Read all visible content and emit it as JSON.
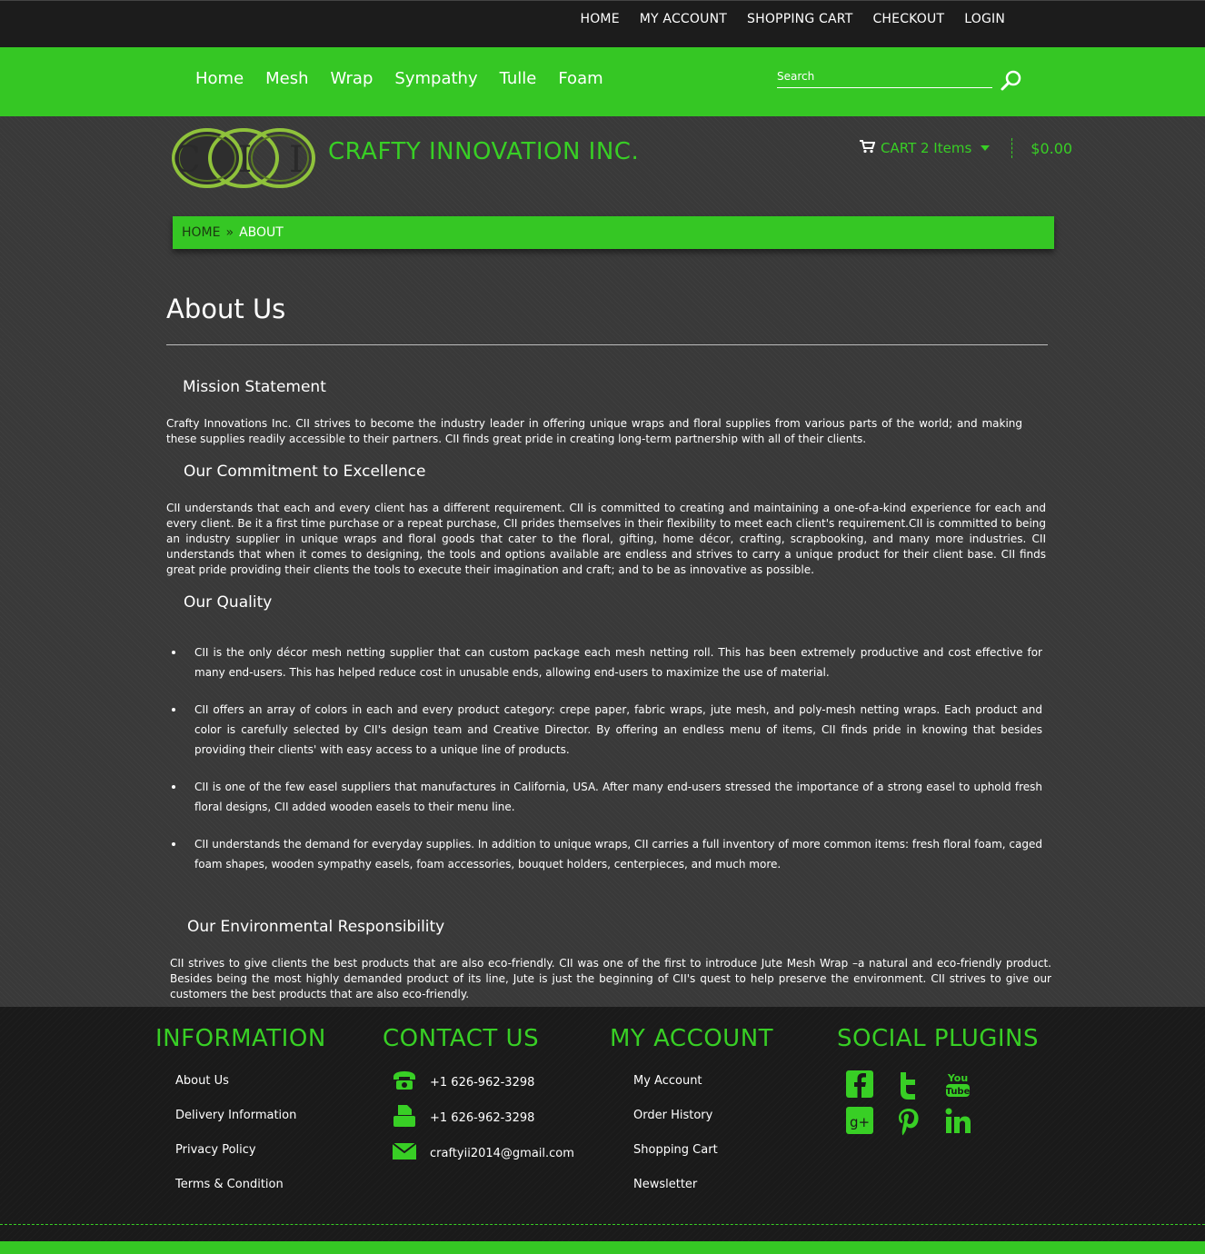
{
  "top_nav": [
    "HOME",
    "MY ACCOUNT",
    "SHOPPING CART",
    "CHECKOUT",
    "LOGIN"
  ],
  "main_nav": [
    "Home",
    "Mesh",
    "Wrap",
    "Sympathy",
    "Tulle",
    "Foam"
  ],
  "search": {
    "placeholder": "Search"
  },
  "brand": {
    "logo_text": "C I I",
    "name": "CRAFTY INNOVATION INC."
  },
  "cart": {
    "label": "CART 2 Items",
    "total": "$0.00"
  },
  "breadcrumb": {
    "home": "HOME",
    "separator": "»",
    "current": "ABOUT"
  },
  "page": {
    "title": "About Us",
    "mission": {
      "heading": "Mission Statement",
      "text": "Crafty Innovations Inc.    CII    strives to become the industry leader in offering unique wraps and floral supplies from various parts of the world; and making these supplies readily accessible to their partners. CII finds great pride in creating long-term partnership with all of their clients."
    },
    "commitment": {
      "heading": "Our Commitment to Excellence",
      "text": "CII understands that each and every client has a different requirement. CII is committed to creating and maintaining a one-of-a-kind experience for each and every client. Be it a first time purchase or a repeat purchase, CII prides themselves in their flexibility to meet each client's requirement.CII is committed to being an industry supplier in unique wraps and floral goods that cater to the floral, gifting, home décor, crafting, scrapbooking, and many more industries. CII understands that when it comes to designing, the tools and options available are endless and strives to carry a unique product for their client base. CII finds great pride providing their clients the tools to execute their imagination and craft; and to be as innovative as possible."
    },
    "quality": {
      "heading": "Our Quality",
      "items": [
        "CII is the only décor mesh netting supplier that can custom package each mesh netting roll. This has been extremely productive and cost effective for many end-users. This has helped reduce cost in unusable ends, allowing end-users to maximize the use of material.",
        "CII offers an array of colors in each and every product category: crepe paper, fabric wraps, jute mesh, and poly-mesh netting wraps. Each product and color is carefully selected by CII's design team and Creative Director. By offering an endless menu of items, CII finds pride in knowing that besides providing their clients' with easy access to a unique line of products.",
        "CII is one of the few easel suppliers that manufactures in California, USA. After many end-users stressed the importance of a strong easel to uphold fresh floral designs, CII added wooden easels to their menu line.",
        "CII understands the demand for everyday supplies. In addition to unique wraps, CII carries a full inventory of more common items: fresh floral foam, caged foam shapes, wooden sympathy easels, foam accessories, bouquet holders, centerpieces, and much more."
      ]
    },
    "environment": {
      "heading": "Our Environmental Responsibility",
      "text": "CII strives to give clients the best products that are also eco-friendly. CII was one of the first to introduce Jute Mesh Wrap –a natural and eco-friendly product. Besides being the most highly demanded product of its line, Jute is just the beginning of CII's quest to help preserve the environment. CII strives to give our customers the best products that are also eco-friendly."
    }
  },
  "footer": {
    "information": {
      "heading": "INFORMATION",
      "links": [
        "About Us",
        "Delivery Information",
        "Privacy Policy",
        "Terms & Condition"
      ]
    },
    "contact": {
      "heading": "CONTACT US",
      "phone": "+1 626-962-3298",
      "fax": "+1 626-962-3298",
      "email": "craftyii2014@gmail.com"
    },
    "account": {
      "heading": "MY ACCOUNT",
      "links": [
        "My Account",
        "Order History",
        "Shopping Cart",
        "Newsletter"
      ]
    },
    "social": {
      "heading": "SOCIAL PLUGINS",
      "youtube_text": "You Tube",
      "googleplus_text": "G+",
      "linkedin_text": "in"
    }
  },
  "colors": {
    "accent": "#35c724",
    "background": "#393939",
    "footer": "#1a1a1a"
  }
}
